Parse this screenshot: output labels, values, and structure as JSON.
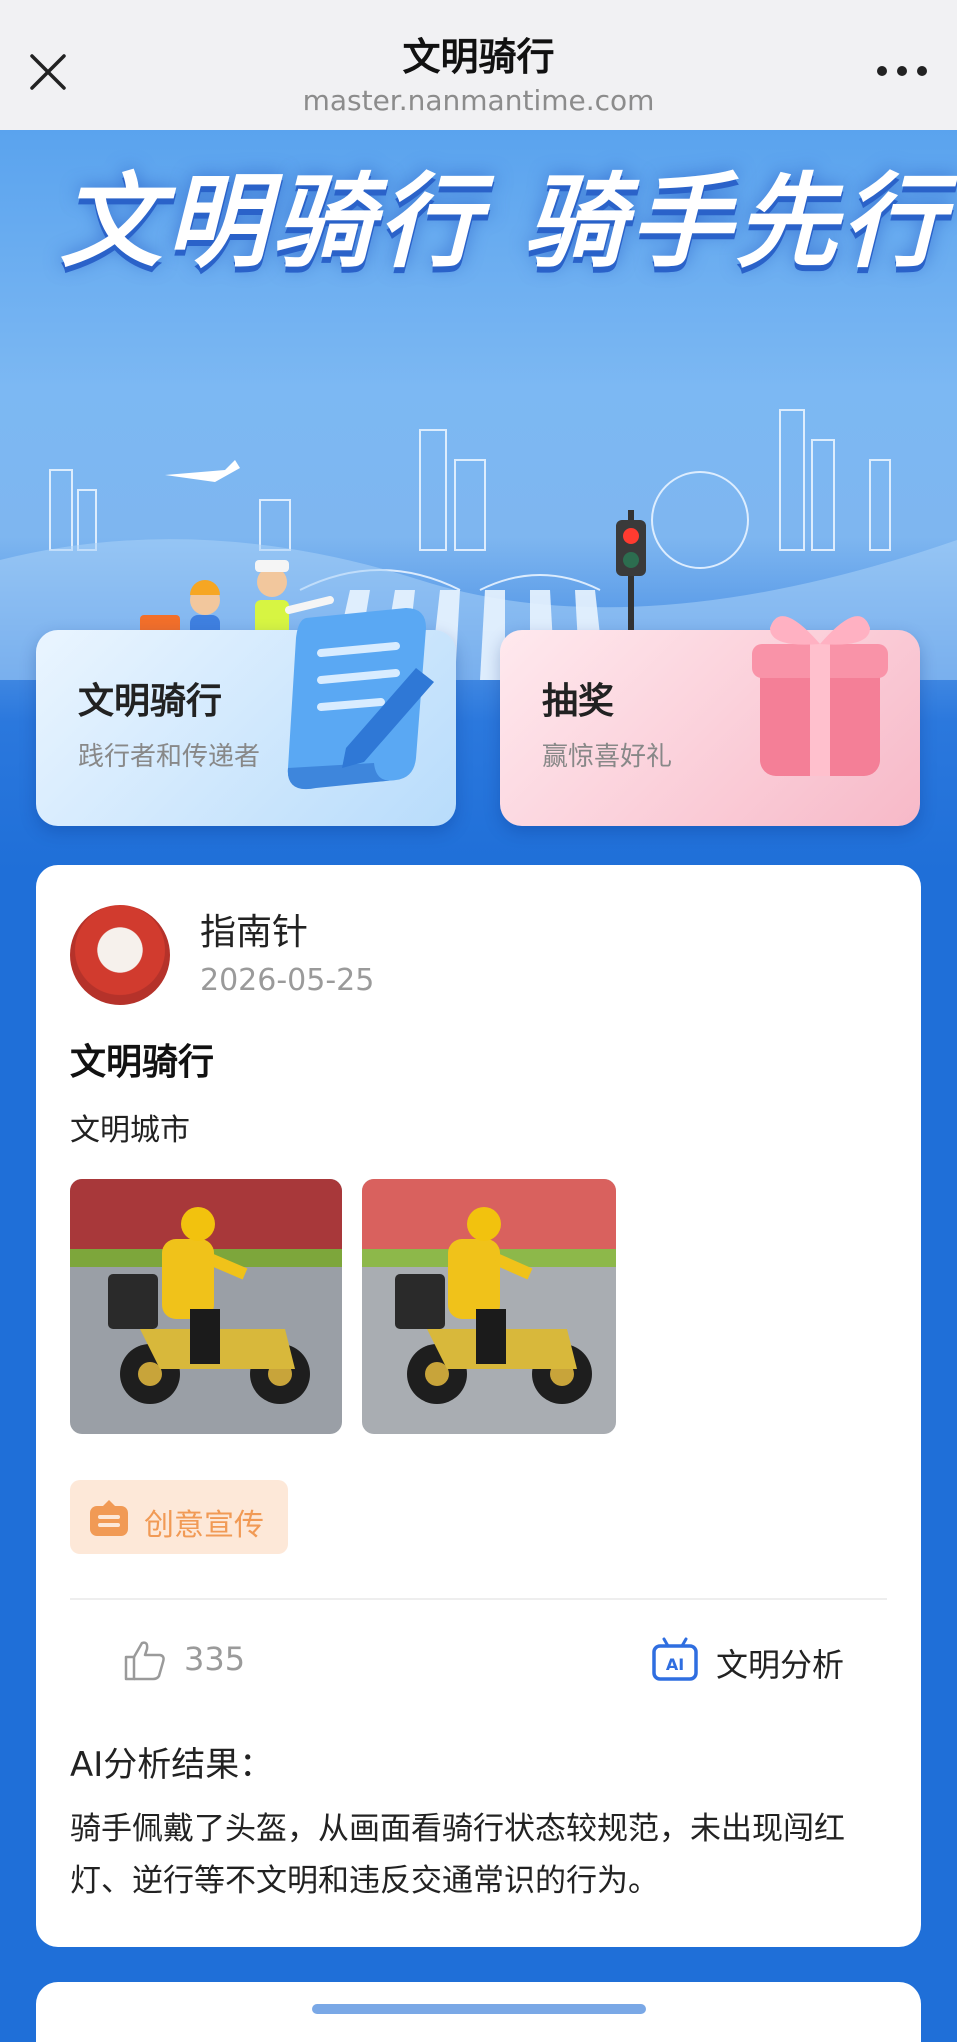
{
  "topbar": {
    "title": "文明骑行",
    "url": "master.nanmantime.com"
  },
  "banner": {
    "title": "文明骑行 骑手先行"
  },
  "cards": [
    {
      "title": "文明骑行",
      "subtitle": "践行者和传递者",
      "icon": "scroll-pen-icon"
    },
    {
      "title": "抽奖",
      "subtitle": "赢惊喜好礼",
      "icon": "gift-box-icon"
    }
  ],
  "post": {
    "username": "指南针",
    "date": "2026-05-25",
    "title": "文明骑行",
    "text": "文明城市",
    "tag": "创意宣传",
    "likes": "335",
    "analysis_label": "文明分析",
    "result_title": "AI分析结果：",
    "result_text": "骑手佩戴了头盔，从画面看骑行状态较规范，未出现闯红灯、逆行等不文明和违反交通常识的行为。"
  },
  "colors": {
    "primary_blue": "#1f6fd8",
    "tag_orange": "#f19a55",
    "tag_bg": "#fde8d8"
  }
}
